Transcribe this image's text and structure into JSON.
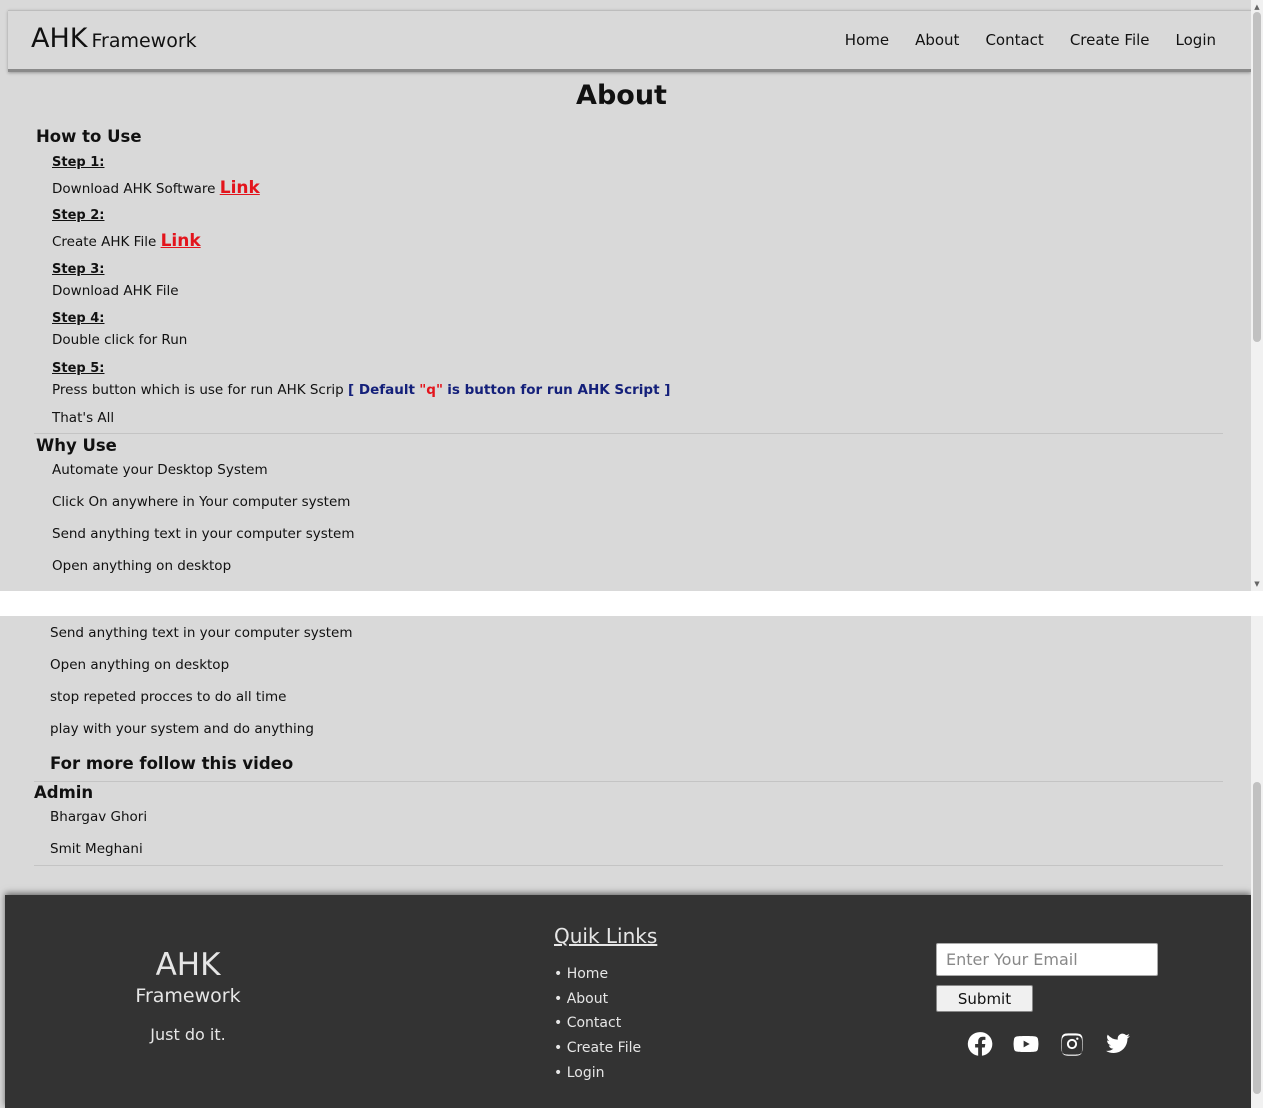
{
  "brand": {
    "name": "AHK",
    "sub": "Framework"
  },
  "nav": [
    "Home",
    "About",
    "Contact",
    "Create File",
    "Login"
  ],
  "page_title": "About",
  "how_to_use": {
    "title": "How to Use",
    "steps": [
      {
        "label": "Step 1:",
        "text": "Download AHK Software",
        "link": "Link"
      },
      {
        "label": "Step 2:",
        "text": "Create AHK File",
        "link": "Link"
      },
      {
        "label": "Step 3:",
        "text": "Download AHK File"
      },
      {
        "label": "Step 4:",
        "text": "Double click for Run"
      },
      {
        "label": "Step 5:",
        "text": "Press button which is use for run AHK Scrip"
      }
    ],
    "step5_note": {
      "open": "[ Default",
      "key": "\"q\"",
      "close": "is button for run AHK Script ]"
    },
    "end": "That's All"
  },
  "why_use": {
    "title": "Why Use",
    "items": [
      "Automate your Desktop System",
      "Click On anywhere in Your computer system",
      "Send anything text in your computer system",
      "Open anything on desktop",
      "stop repeted procces to do all time",
      "play with your system and do anything"
    ],
    "video": "For more follow this video"
  },
  "admin": {
    "title": "Admin",
    "names": [
      "Bhargav Ghori",
      "Smit Meghani"
    ]
  },
  "footer": {
    "brand": "AHK",
    "sub": "Framework",
    "tagline": "Just do it.",
    "links_title": "Quik Links",
    "links": [
      "• Home",
      "• About",
      "• Contact",
      "• Create File",
      "• Login"
    ],
    "email_placeholder": "Enter Your Email",
    "submit": "Submit",
    "socials": [
      "facebook-icon",
      "youtube-icon",
      "instagram-icon",
      "twitter-icon"
    ]
  },
  "colors": {
    "background": "#d9d9d9",
    "footer": "#333333",
    "link_red": "#e3141c",
    "note_navy": "#14207a"
  }
}
